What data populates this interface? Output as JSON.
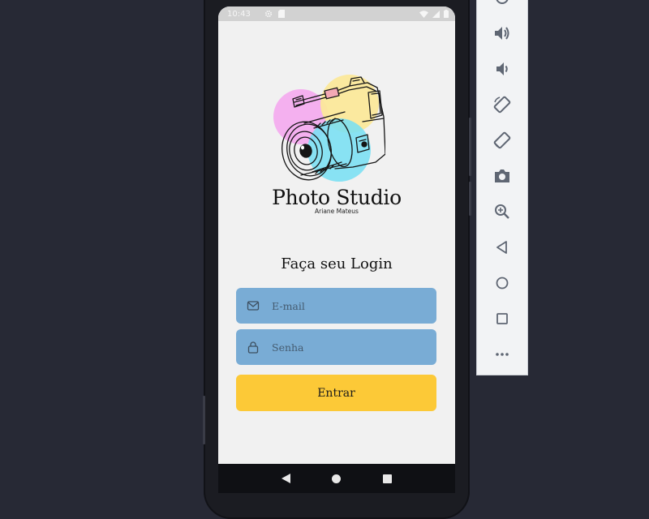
{
  "status_bar": {
    "time": "10:43"
  },
  "brand": {
    "title": "Photo Studio",
    "subtitle": "Ariane Mateus"
  },
  "login": {
    "title": "Faça seu Login"
  },
  "fields": {
    "email": {
      "placeholder": "E-mail",
      "value": ""
    },
    "password": {
      "placeholder": "Senha",
      "value": ""
    }
  },
  "button": {
    "label": "Entrar"
  },
  "colors": {
    "field_bg": "#79acd5",
    "button_bg": "#fcc937",
    "screen_bg": "#f1f1f1",
    "desktop_bg": "#272935"
  },
  "nav": {
    "back_icon": "back-triangle-icon",
    "home_icon": "home-circle-icon",
    "recents_icon": "recents-square-icon"
  },
  "toolbar": {
    "items": [
      "power-icon",
      "volume-up-icon",
      "volume-down-icon",
      "rotate-left-icon",
      "rotate-right-icon",
      "camera-icon",
      "zoom-icon",
      "back-icon",
      "home-icon",
      "overview-icon",
      "more-icon"
    ]
  }
}
